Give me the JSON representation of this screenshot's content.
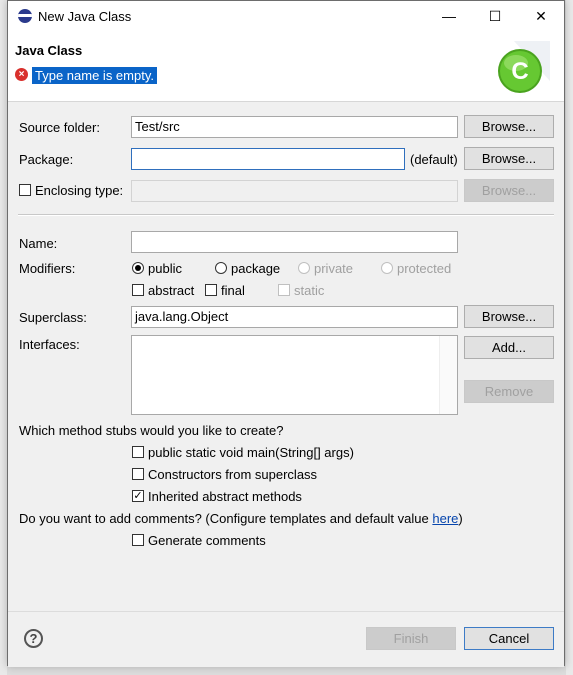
{
  "window": {
    "title": "New Java Class",
    "minimize_glyph": "—",
    "maximize_glyph": "☐",
    "close_glyph": "✕"
  },
  "banner": {
    "title": "Java Class",
    "message": "Type name is empty.",
    "logo_letter": "C",
    "error_glyph": "×"
  },
  "form": {
    "source_folder": {
      "label": "Source folder:",
      "value": "Test/src",
      "browse": "Browse..."
    },
    "package": {
      "label": "Package:",
      "value": "",
      "suffix": "(default)",
      "browse": "Browse..."
    },
    "enclosing_type": {
      "label": "Enclosing type:",
      "value": "",
      "browse": "Browse...",
      "checked": false
    },
    "name": {
      "label": "Name:",
      "value": ""
    },
    "modifiers": {
      "label": "Modifiers:",
      "radios": [
        "public",
        "package",
        "private",
        "protected"
      ],
      "checks": [
        "abstract",
        "final",
        "static"
      ]
    },
    "superclass": {
      "label": "Superclass:",
      "value": "java.lang.Object",
      "browse": "Browse..."
    },
    "interfaces": {
      "label": "Interfaces:",
      "add": "Add...",
      "remove": "Remove"
    },
    "stubs": {
      "question": "Which method stubs would you like to create?",
      "options": [
        "public static void main(String[] args)",
        "Constructors from superclass",
        "Inherited abstract methods"
      ],
      "checked": [
        false,
        false,
        true
      ]
    },
    "comments": {
      "question_prefix": "Do you want to add comments? (Configure templates and default value ",
      "link": "here",
      "question_suffix": ")",
      "option": "Generate comments"
    }
  },
  "footer": {
    "help_glyph": "?",
    "finish": "Finish",
    "cancel": "Cancel"
  },
  "colors": {
    "accent": "#0a64c8",
    "error": "#d9302c",
    "logo_green": "#5fc42b"
  }
}
